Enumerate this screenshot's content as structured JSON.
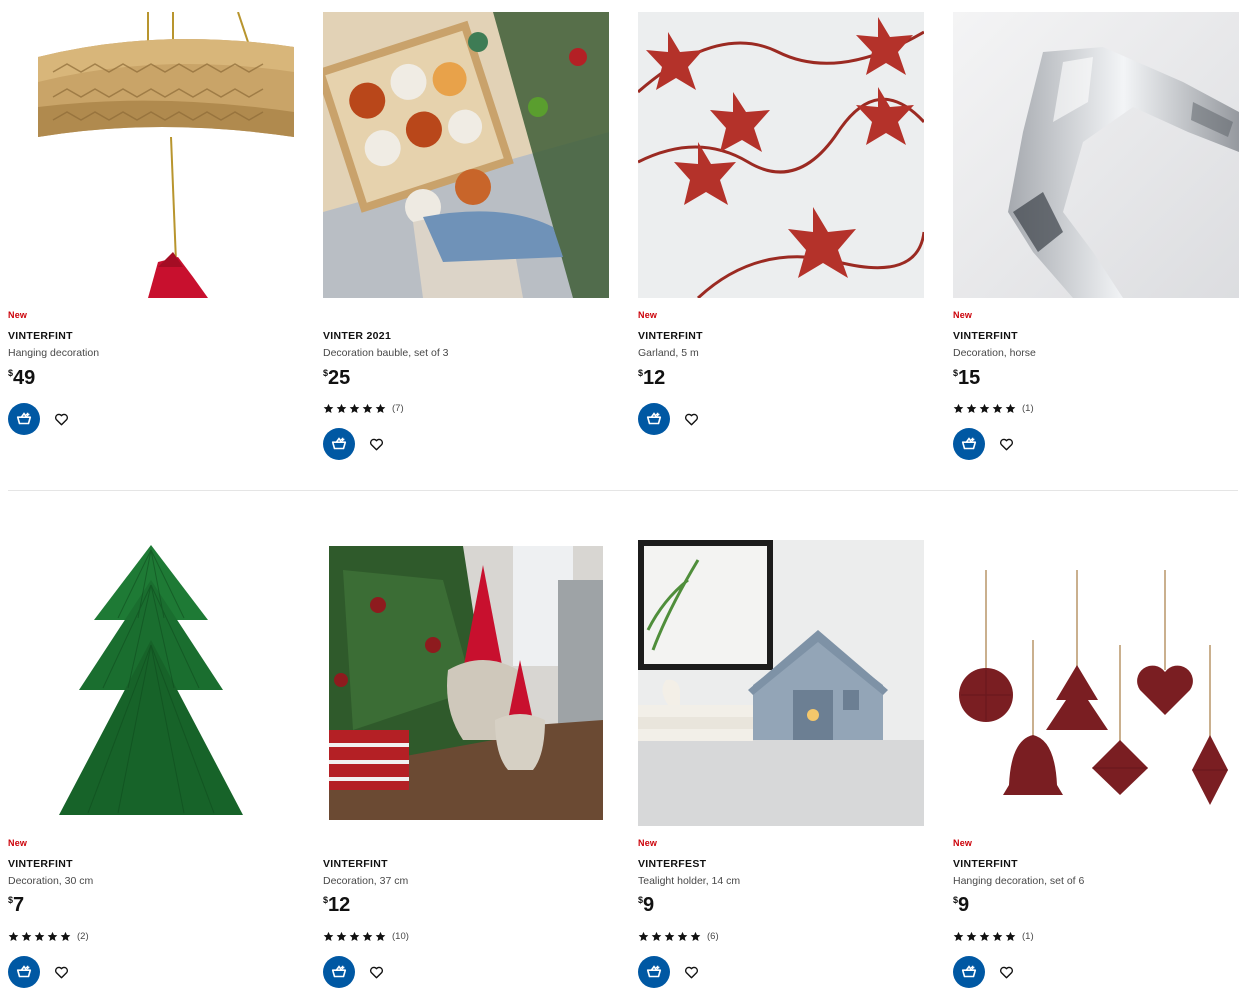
{
  "products": [
    {
      "badge": "New",
      "name": "VINTERFINT",
      "description": "Hanging decoration",
      "currency": "$",
      "price": "49",
      "rating_count": "",
      "has_rating": false,
      "icons": {
        "cart": "add-to-cart-icon",
        "favourite": "heart-icon"
      }
    },
    {
      "badge": "",
      "name": "VINTER 2021",
      "description": "Decoration bauble, set of 3",
      "currency": "$",
      "price": "25",
      "rating_count": "(7)",
      "has_rating": true,
      "stars": 5
    },
    {
      "badge": "New",
      "name": "VINTERFINT",
      "description": "Garland, 5 m",
      "currency": "$",
      "price": "12",
      "rating_count": "",
      "has_rating": false
    },
    {
      "badge": "New",
      "name": "VINTERFINT",
      "description": "Decoration, horse",
      "currency": "$",
      "price": "15",
      "rating_count": "(1)",
      "has_rating": true,
      "stars": 5
    },
    {
      "badge": "New",
      "name": "VINTERFINT",
      "description": "Decoration, 30 cm",
      "currency": "$",
      "price": "7",
      "rating_count": "(2)",
      "has_rating": true,
      "stars": 5
    },
    {
      "badge": "",
      "name": "VINTERFINT",
      "description": "Decoration, 37 cm",
      "currency": "$",
      "price": "12",
      "rating_count": "(10)",
      "has_rating": true,
      "stars": 5
    },
    {
      "badge": "New",
      "name": "VINTERFEST",
      "description": "Tealight holder, 14 cm",
      "currency": "$",
      "price": "9",
      "rating_count": "(6)",
      "has_rating": true,
      "stars": 5
    },
    {
      "badge": "New",
      "name": "VINTERFINT",
      "description": "Hanging decoration, set of 6",
      "currency": "$",
      "price": "9",
      "rating_count": "(1)",
      "has_rating": true,
      "stars": 5
    }
  ],
  "colors": {
    "new_badge": "#cc0008",
    "cart_button": "#0058a3",
    "text": "#111111",
    "muted": "#484848"
  }
}
